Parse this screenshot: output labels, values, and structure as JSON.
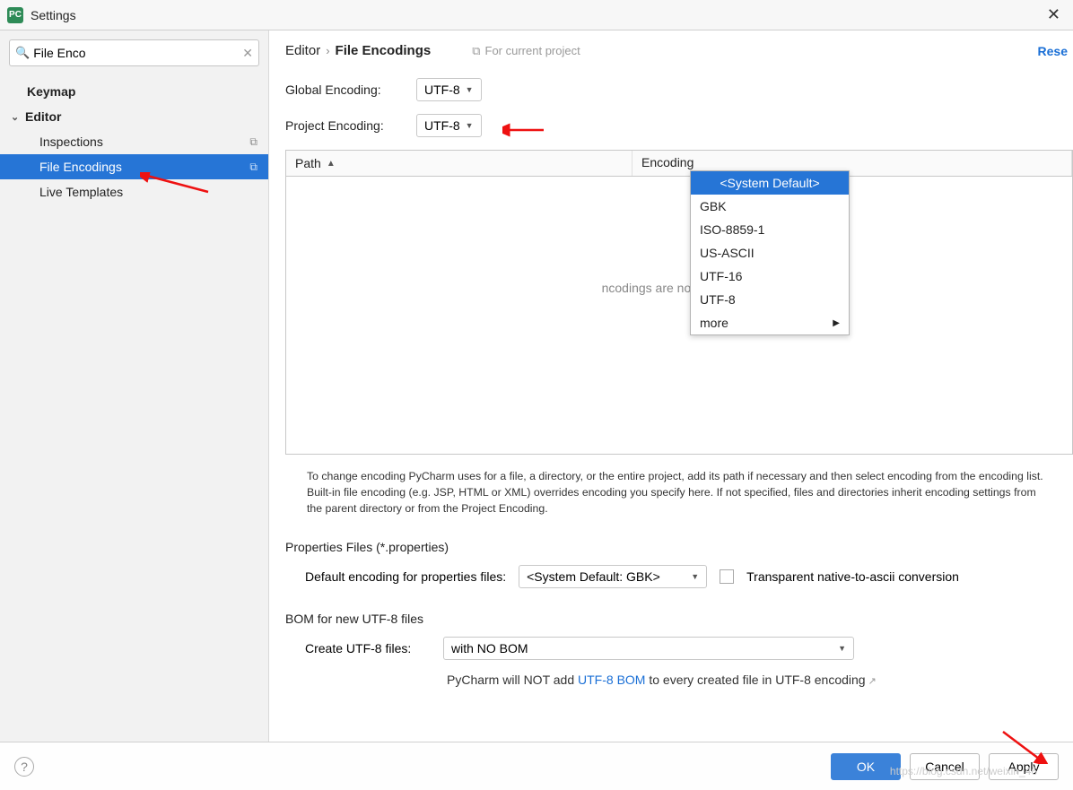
{
  "window": {
    "title": "Settings"
  },
  "search": {
    "value": "File Enco"
  },
  "sidebar": {
    "items": [
      {
        "label": "Keymap"
      },
      {
        "label": "Editor"
      },
      {
        "label": "Inspections"
      },
      {
        "label": "File Encodings"
      },
      {
        "label": "Live Templates"
      }
    ]
  },
  "breadcrumb": {
    "root": "Editor",
    "leaf": "File Encodings",
    "scope": "For current project",
    "reset": "Rese"
  },
  "global_encoding": {
    "label": "Global Encoding:",
    "value": "UTF-8"
  },
  "project_encoding": {
    "label": "Project Encoding:",
    "value": "UTF-8"
  },
  "dropdown": {
    "options": [
      "<System Default>",
      "GBK",
      "ISO-8859-1",
      "US-ASCII",
      "UTF-16",
      "UTF-8",
      "more"
    ]
  },
  "table": {
    "cols": {
      "c1": "Path",
      "c2": "Encoding"
    },
    "empty": "ncodings are not configured"
  },
  "hint": "To change encoding PyCharm uses for a file, a directory, or the entire project, add its path if necessary and then select encoding from the encoding list. Built-in file encoding (e.g. JSP, HTML or XML) overrides encoding you specify here. If not specified, files and directories inherit encoding settings from the parent directory or from the Project Encoding.",
  "properties": {
    "title": "Properties Files (*.properties)",
    "label": "Default encoding for properties files:",
    "value": "<System Default: GBK>",
    "checkbox_label": "Transparent native-to-ascii conversion"
  },
  "bom": {
    "title": "BOM for new UTF-8 files",
    "label": "Create UTF-8 files:",
    "value": "with NO BOM",
    "desc_pre": "PyCharm will NOT add ",
    "desc_link": "UTF-8 BOM",
    "desc_post": " to every created file in UTF-8 encoding"
  },
  "footer": {
    "ok": "OK",
    "cancel": "Cancel",
    "apply": "Apply"
  },
  "watermark": "https://blog.csdn.net/weixin_46"
}
